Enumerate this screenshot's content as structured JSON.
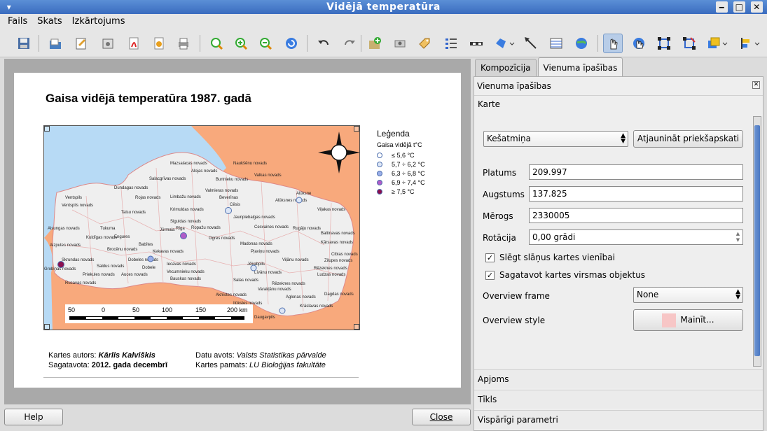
{
  "window": {
    "title": "Vidējā temperatūra"
  },
  "menu": [
    "Fails",
    "Skats",
    "Izkārtojums"
  ],
  "toolbar": {
    "icons": [
      "save-icon",
      "open-icon",
      "new-composer-icon",
      "export-image-icon",
      "export-pdf-icon",
      "export-svg-icon",
      "print-icon",
      "zoom-full-icon",
      "zoom-in-icon",
      "zoom-out-icon",
      "refresh-icon",
      "undo-icon",
      "redo-icon",
      "add-map-icon",
      "add-image-icon",
      "add-label-icon",
      "add-legend-icon",
      "add-scalebar-icon",
      "add-shape-icon",
      "add-arrow-icon",
      "add-table-icon",
      "add-html-icon",
      "select-move-icon",
      "move-content-icon",
      "group-icon",
      "ungroup-icon",
      "raise-icon",
      "align-icon"
    ]
  },
  "composition": {
    "title": "Gaisa vidējā temperatūra 1987. gadā",
    "legend": {
      "title": "Leģenda",
      "subtitle": "Gaisa vidējā t°C",
      "items": [
        {
          "label": "≤ 5,6 °C",
          "color": "#ffffff"
        },
        {
          "label": "5,7 ÷ 6,2 °C",
          "color": "#dde7f7"
        },
        {
          "label": "6,3 ÷ 6,8 °C",
          "color": "#9aaee8"
        },
        {
          "label": "6,9 ÷ 7,4 °C",
          "color": "#b05cc8"
        },
        {
          "label": "≥ 7,5 °C",
          "color": "#8b0f4f"
        }
      ]
    },
    "scalebar": {
      "labels": [
        "50",
        "0",
        "50",
        "100",
        "150",
        "200 km"
      ]
    },
    "footer": {
      "author_label": "Kartes autors: ",
      "author": "Kārlis Kalviškis",
      "prepared_label": "Sagatavota: ",
      "prepared": "2012. gada decembrī",
      "source_label": "Datu avots: ",
      "source": "Valsts Statistikas pārvalde",
      "base_label": "Kartes pamats: ",
      "base": "LU Bioloģijas fakultāte"
    }
  },
  "buttons": {
    "help": "Help",
    "close": "Close"
  },
  "tabs": [
    {
      "label": "Kompozīcija"
    },
    {
      "label": "Vienuma īpašības"
    }
  ],
  "panel": {
    "header": "Vienuma īpašības",
    "section": "Karte",
    "preview_mode": "Kešatmiņa",
    "update_preview": "Atjaunināt priekšapskati",
    "fields": [
      {
        "label": "Platums",
        "value": "209.997"
      },
      {
        "label": "Augstums",
        "value": "137.825"
      },
      {
        "label": "Mērogs",
        "value": "2330005"
      }
    ],
    "rotation_label": "Rotācija",
    "rotation_value": "0,00 grādi",
    "lock_layers": "Slēgt slāņus kartes vienībai",
    "draw_canvas": "Sagatavot kartes virsmas objektus",
    "overview_frame_label": "Overview frame",
    "overview_frame_value": "None",
    "overview_style_label": "Overview style",
    "overview_style_button": "Mainīt...",
    "sections_collapsed": [
      "Apjoms",
      "Tīkls",
      "Vispārīgi parametri"
    ]
  }
}
